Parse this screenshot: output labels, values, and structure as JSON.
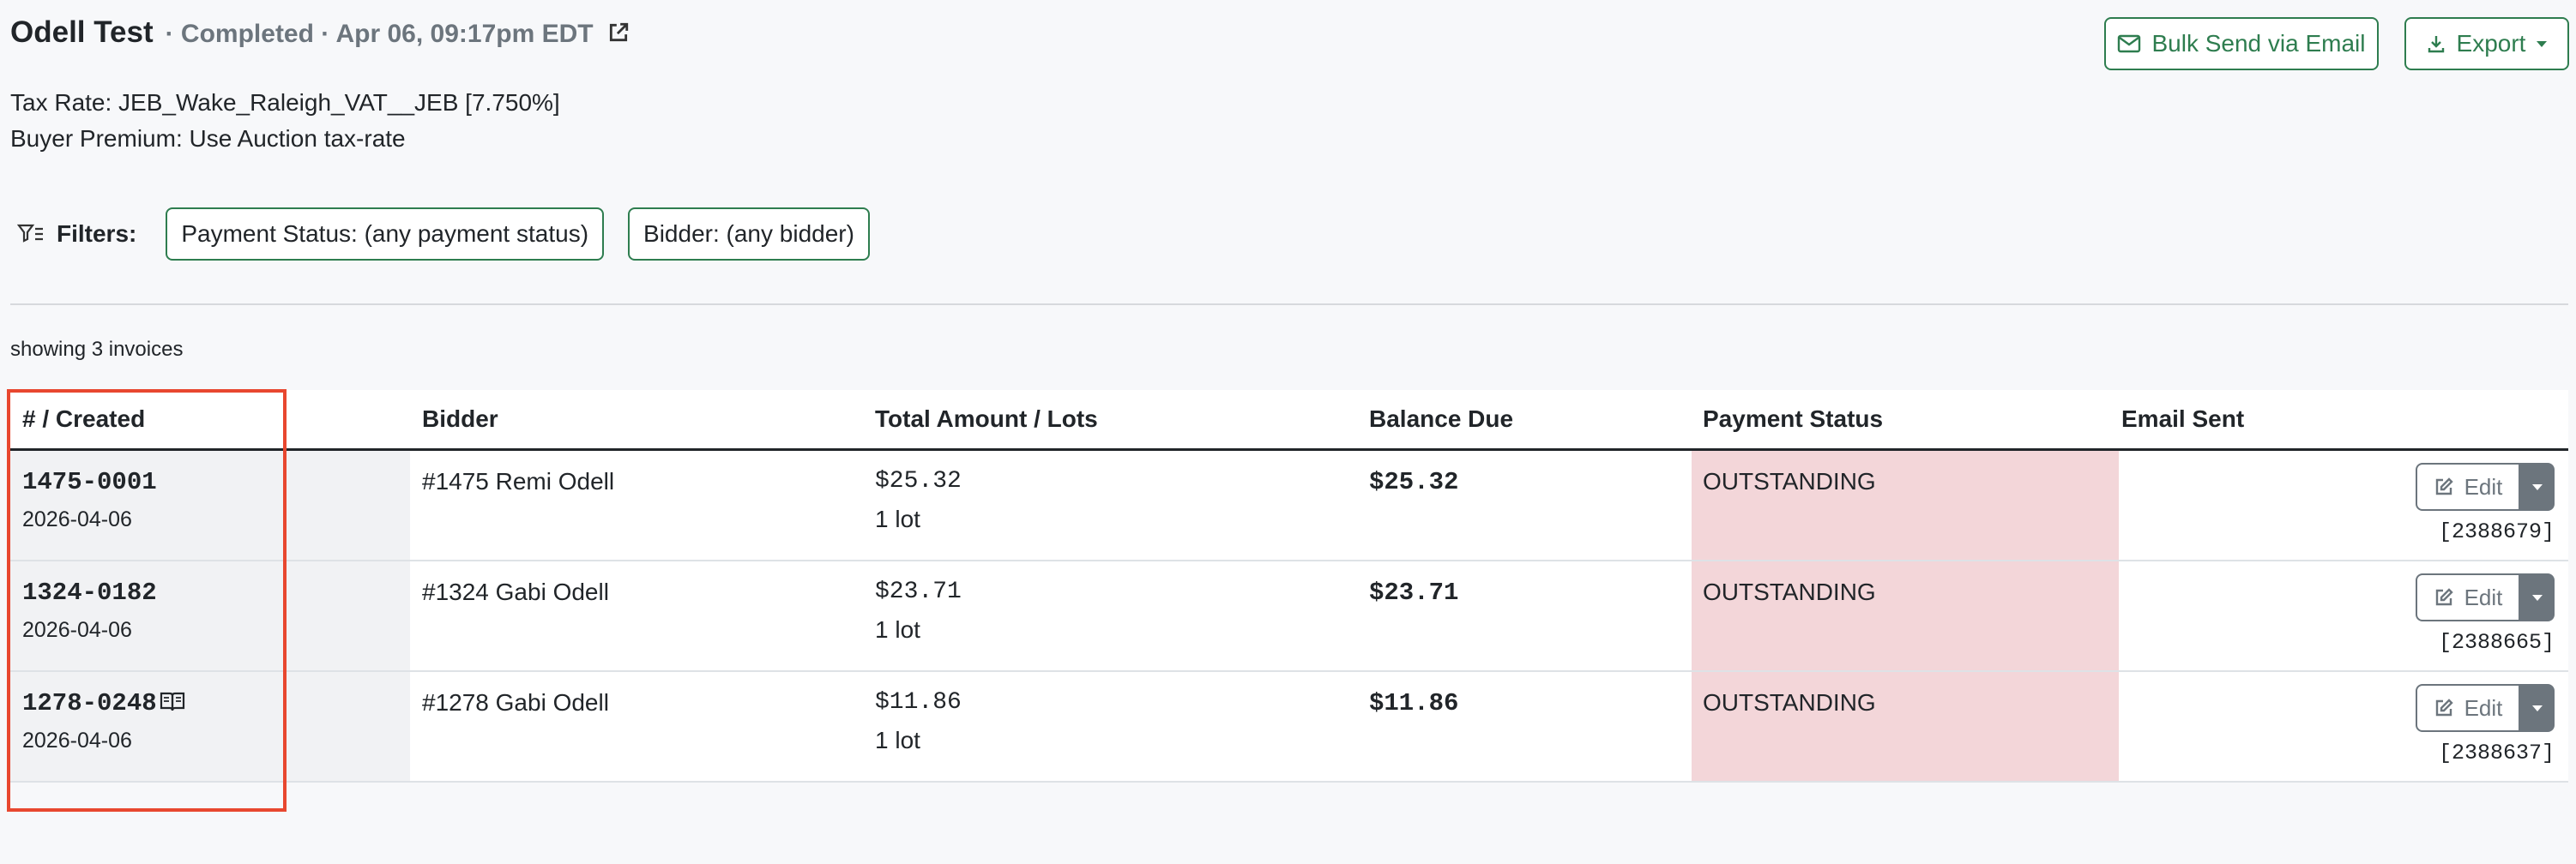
{
  "header": {
    "title": "Odell Test",
    "subtitle": "· Completed · Apr 06, 09:17pm EDT",
    "tax_rate": "Tax Rate: JEB_Wake_Raleigh_VAT__JEB [7.750%]",
    "buyer_premium": "Buyer Premium: Use Auction tax-rate"
  },
  "actions": {
    "bulk_send_label": "Bulk Send via Email",
    "export_label": "Export"
  },
  "filters": {
    "label": "Filters:",
    "payment_status": "Payment Status: (any payment status)",
    "bidder": "Bidder: (any bidder)"
  },
  "summary": "showing 3 invoices",
  "table": {
    "headers": [
      "# / Created",
      "Bidder",
      "Total Amount / Lots",
      "Balance Due",
      "Payment Status",
      "Email Sent"
    ],
    "rows": [
      {
        "invoice": "1475-0001",
        "created": "2026-04-06",
        "bidder": "#1475 Remi Odell",
        "total": "$25.32",
        "lots": "1 lot",
        "balance": "$25.32",
        "status": "OUTSTANDING",
        "edit": "Edit",
        "id": "[2388679]",
        "has_note_icon": false
      },
      {
        "invoice": "1324-0182",
        "created": "2026-04-06",
        "bidder": "#1324 Gabi Odell",
        "total": "$23.71",
        "lots": "1 lot",
        "balance": "$23.71",
        "status": "OUTSTANDING",
        "edit": "Edit",
        "id": "[2388665]",
        "has_note_icon": false
      },
      {
        "invoice": "1278-0248",
        "created": "2026-04-06",
        "bidder": "#1278 Gabi Odell",
        "total": "$11.86",
        "lots": "1 lot",
        "balance": "$11.86",
        "status": "OUTSTANDING",
        "edit": "Edit",
        "id": "[2388637]",
        "has_note_icon": true
      }
    ]
  },
  "colors": {
    "accent_green": "#2e7d4f",
    "status_outstanding_bg": "#f3d6d9",
    "highlight_border": "#e8472f"
  },
  "icons": {
    "external_link": "external-link-icon",
    "envelope": "envelope-icon",
    "download": "download-icon",
    "filter": "filter-icon",
    "edit": "edit-icon",
    "note": "book-icon"
  }
}
